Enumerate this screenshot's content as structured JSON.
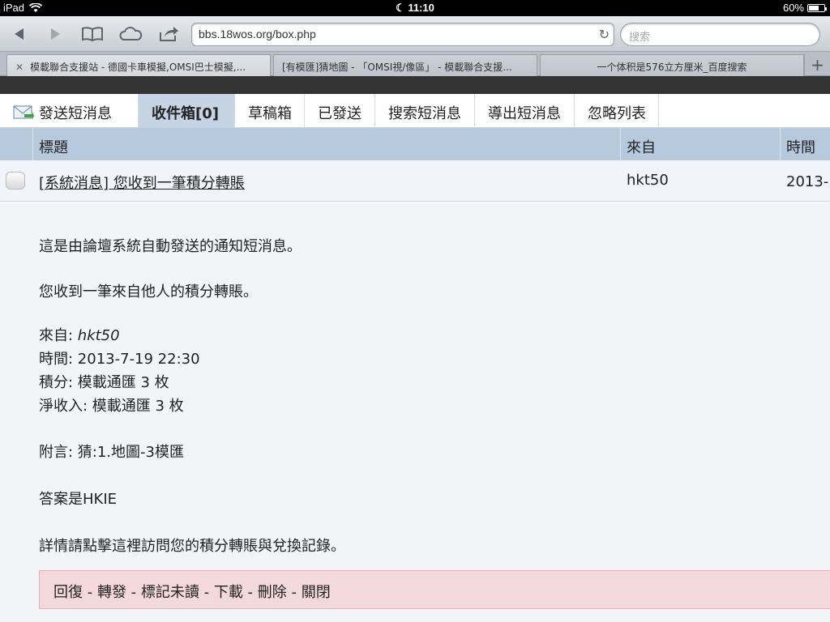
{
  "statusbar": {
    "device": "iPad",
    "time": "11:10",
    "battery": "60%",
    "battery_level": 0.6
  },
  "browser": {
    "url": "bbs.18wos.org/box.php",
    "search_placeholder": "搜索",
    "tabs": [
      {
        "label": "模載聯合支援站 - 德國卡車模擬,OMSI巴士模擬,..."
      },
      {
        "label": "[有模匯]猜地圖 - 「OMSI視/像區」 - 模載聯合支援..."
      },
      {
        "label": "一个体积是576立方厘米_百度搜索"
      }
    ]
  },
  "pm": {
    "tabs": [
      {
        "label": "發送短消息"
      },
      {
        "label": "收件箱[0]"
      },
      {
        "label": "草稿箱"
      },
      {
        "label": "已發送"
      },
      {
        "label": "搜索短消息"
      },
      {
        "label": "導出短消息"
      },
      {
        "label": "忽略列表"
      }
    ],
    "columns": {
      "subject": "標題",
      "from": "來自",
      "time": "時間"
    },
    "message": {
      "subject": "[系統消息] 您收到一筆積分轉賬",
      "from": "hkt50",
      "time": "2013-"
    },
    "body": {
      "line1": "這是由論壇系統自動發送的通知短消息。",
      "line2": "您收到一筆來自他人的積分轉賬。",
      "from_label": "來自: ",
      "from_value": "hkt50",
      "time_line": "時間: 2013-7-19 22:30",
      "points_line": "積分: 模載通匯 3 枚",
      "net_line": "淨收入: 模載通匯 3 枚",
      "note_line": "附言: 猜:1.地圖-3模匯",
      "answer_line": "答案是HKIE",
      "detail_line": "詳情請點擊這裡訪問您的積分轉賬與兌換記錄。"
    },
    "actions": "回復 - 轉發 - 標記未讀 - 下載 - 刪除 - 關閉"
  }
}
